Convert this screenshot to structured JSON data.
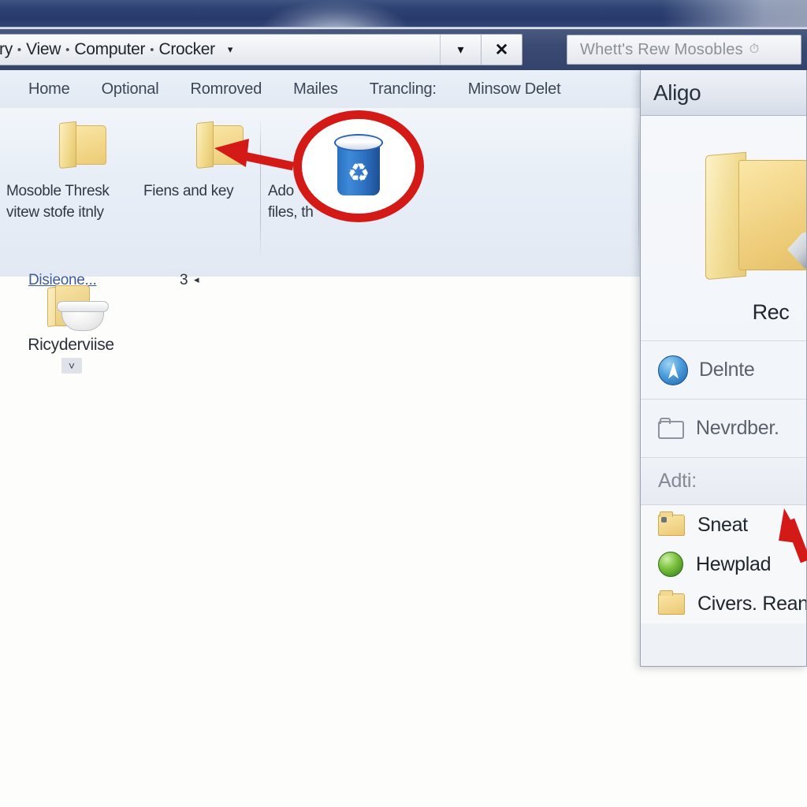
{
  "window": {
    "titlebar_color": "#2e4373"
  },
  "address_bar": {
    "crumbs": [
      "ry",
      "View",
      "Computer",
      "Crocker"
    ],
    "separator": "•",
    "dropdown_caret_icon": "▾",
    "history_dropdown_icon": "▾",
    "close_icon": "✕"
  },
  "search": {
    "text": "Whett's Rew Mosobles",
    "icon": "⏱"
  },
  "ribbon": {
    "tabs": [
      {
        "label": "Home"
      },
      {
        "label": "Optional"
      },
      {
        "label": "Romroved"
      },
      {
        "label": "Mailes"
      },
      {
        "label": "Trancling:"
      },
      {
        "label": "Minsow Delet"
      }
    ],
    "groups": [
      {
        "icon": "folder-icon",
        "caption": "Mosoble Thresk\nvitew stofe itnly"
      },
      {
        "icon": "folder-icon",
        "caption": "Fiens and key"
      },
      {
        "icon": "folder-icon",
        "caption": "Ado\nfiles, th"
      }
    ],
    "footer": {
      "link": "Disieone...",
      "count": "3",
      "caret_icon": "◂"
    }
  },
  "desktop": {
    "item": {
      "label": "Ricyderviise",
      "icon": "recycle-bin-folder-icon",
      "caret_icon": "˅"
    }
  },
  "panel": {
    "title": "Aligo",
    "hero": {
      "icon": "folder-with-pen-icon",
      "label": "Rec"
    },
    "actions": [
      {
        "icon": "delete-icon",
        "label": "Delnte"
      },
      {
        "icon": "new-folder-icon",
        "label": "Nevrdber."
      }
    ],
    "section_label": "Adti:",
    "items": [
      {
        "icon": "folder-icon",
        "label": "Sneat",
        "accesskey": "S"
      },
      {
        "icon": "globe-icon",
        "label": "Hewplad",
        "accesskey": ""
      },
      {
        "icon": "folder-icon",
        "label": "Civers. Reangl",
        "accesskey": "s"
      }
    ]
  },
  "annotations": {
    "highlight_color": "#d41a17",
    "callout_icon": "recycle-bin-icon",
    "recycle_glyph": "♻",
    "arrow_left": "left-pointing-arrow",
    "arrow_corner": "up-left-pointing-arrow"
  }
}
